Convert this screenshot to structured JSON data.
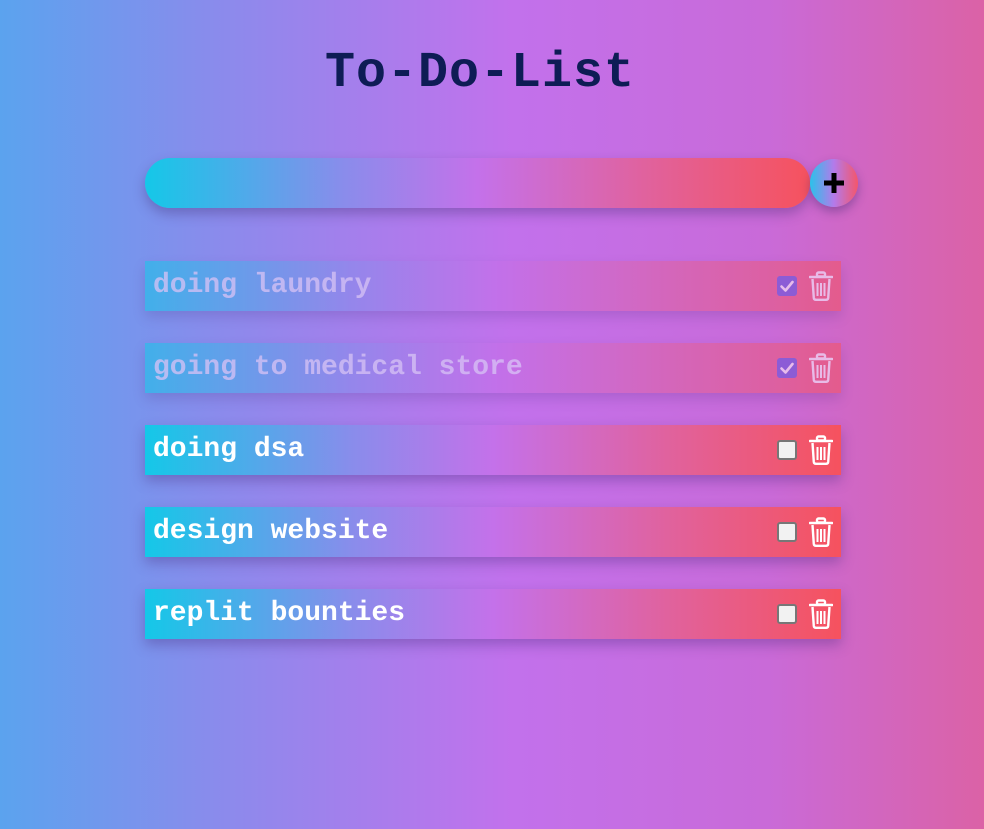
{
  "app": {
    "title": "To-Do-List"
  },
  "input": {
    "value": "",
    "placeholder": "",
    "add_icon": "plus-icon"
  },
  "tasks": [
    {
      "text": "doing laundry",
      "completed": true
    },
    {
      "text": "going to medical store",
      "completed": true
    },
    {
      "text": "doing dsa",
      "completed": false
    },
    {
      "text": "design website",
      "completed": false
    },
    {
      "text": "replit bounties",
      "completed": false
    }
  ],
  "icons": {
    "check": "check-icon",
    "delete": "trash-icon"
  },
  "colors": {
    "title": "#0e1c55",
    "checkbox_checked": "#5a52d8",
    "gradient_start": "#14c8e8",
    "gradient_end": "#f6525e"
  }
}
